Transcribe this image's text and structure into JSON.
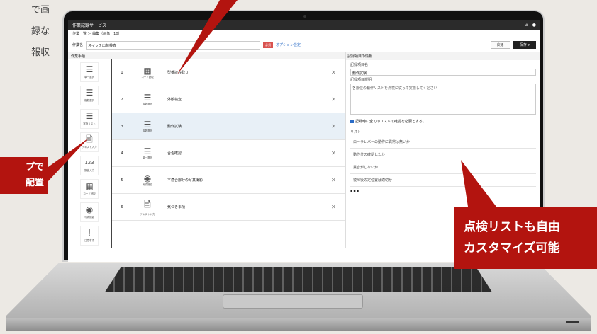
{
  "bg_text": [
    "で画",
    "録な",
    "報収"
  ],
  "callout_left": [
    "プで",
    "配置"
  ],
  "callout_right": [
    "点検リストも自由",
    "カスタマイズ可能"
  ],
  "app": {
    "title": "作業記録サービス",
    "breadcrumb": "作業一覧 ＞ 編集（画像：10）",
    "job_label": "作業名",
    "job_value": "スイッチ出荷検査",
    "required_badge": "必須",
    "option_link": "オプション設定",
    "back_button": "戻る",
    "save_button": "保存 ▾",
    "left_header": "作業手順",
    "palette": [
      {
        "label": "単一選択",
        "icon": "☰"
      },
      {
        "label": "複数選択",
        "icon": "☰"
      },
      {
        "label": "実施リスト",
        "icon": "☰"
      },
      {
        "label": "テキスト入力",
        "icon": "🖹"
      },
      {
        "label": "数値入力",
        "icon": "123"
      },
      {
        "label": "コード読取",
        "icon": "▦"
      },
      {
        "label": "写真撮影",
        "icon": "◉"
      },
      {
        "label": "注意事項",
        "icon": "!"
      }
    ],
    "steps": [
      {
        "num": "1",
        "icon": "▦",
        "type": "コード読取",
        "name": "型番読み取り"
      },
      {
        "num": "2",
        "icon": "☰",
        "type": "複数選択",
        "name": "外観検査"
      },
      {
        "num": "3",
        "icon": "☰",
        "type": "複数選択",
        "name": "動作試験"
      },
      {
        "num": "4",
        "icon": "☰",
        "type": "単一選択",
        "name": "合否確認"
      },
      {
        "num": "5",
        "icon": "◉",
        "type": "写真撮影",
        "name": "不適合部分の写真撮影"
      },
      {
        "num": "6",
        "icon": "🖹",
        "type": "テキスト入力",
        "name": "気づき事項"
      }
    ],
    "right_header": "記録項目の情報",
    "item_name_label": "記録項目名",
    "item_name_value": "動作試験",
    "item_desc_label": "記録項目説明",
    "item_desc_value": "各部位の動作リストを点検に従って実施してください",
    "check_label": "記録時に全てのリストの確認を必要とする。",
    "list_label": "リスト",
    "list_items": [
      "ローラレバーの動作に異常は無いか",
      "動作位の確認したか",
      "異音がしないか",
      "復帰後の定位置は適切か"
    ],
    "tools": "▪▪▪"
  },
  "colors": {
    "accent": "#b3140f",
    "titlebar": "#2b2b2b",
    "selected": "#e8f0f7"
  }
}
